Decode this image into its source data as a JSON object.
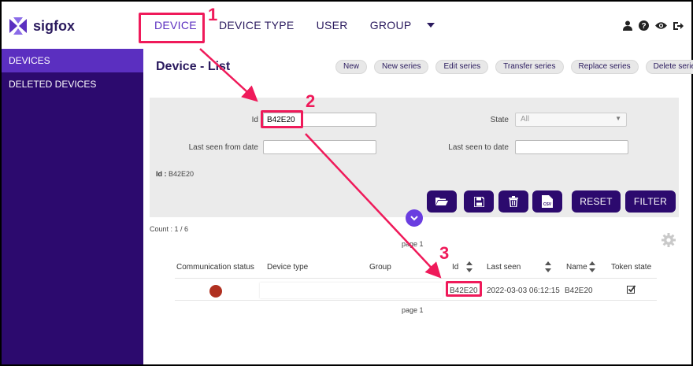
{
  "brand": {
    "name": "sigfox",
    "color": "#5b2fc0",
    "dark": "#2c0a6e",
    "accent": "#ef1a5a"
  },
  "nav": {
    "items": [
      "DEVICE",
      "DEVICE TYPE",
      "USER",
      "GROUP"
    ],
    "more_icon": "caret-down-icon"
  },
  "header_icons": [
    "user-icon",
    "help-icon",
    "eye-icon",
    "logout-icon"
  ],
  "sidebar": {
    "items": [
      {
        "label": "DEVICES",
        "active": true
      },
      {
        "label": "DELETED DEVICES",
        "active": false
      }
    ]
  },
  "page": {
    "title": "Device - List",
    "actions": [
      "New",
      "New series",
      "Edit series",
      "Transfer series",
      "Replace series",
      "Delete series"
    ]
  },
  "filters": {
    "id_label": "Id",
    "id_value": "B42E20",
    "state_label": "State",
    "state_value": "All",
    "last_seen_from_label": "Last seen from date",
    "last_seen_from_value": "",
    "last_seen_to_label": "Last seen to date",
    "last_seen_to_value": "",
    "summary_key": "Id",
    "summary_value": "B42E20",
    "buttons": {
      "open": "folder-open-icon",
      "save": "save-icon",
      "delete": "trash-icon",
      "export": "csv-icon",
      "reset": "RESET",
      "filter": "FILTER"
    }
  },
  "results": {
    "count": "Count : 1 / 6",
    "page_top": "page 1",
    "page_bottom": "page 1",
    "columns": [
      "Communication status",
      "Device type",
      "Group",
      "Id",
      "Last seen",
      "Name",
      "Token state"
    ],
    "rows": [
      {
        "status_color": "#b03020",
        "device_type": "",
        "group": "",
        "id": "B42E20",
        "last_seen": "2022-03-03 06:12:15",
        "name": "B42E20",
        "token_state": "checked"
      }
    ]
  },
  "annotations": {
    "steps": [
      "1",
      "2",
      "3"
    ]
  }
}
